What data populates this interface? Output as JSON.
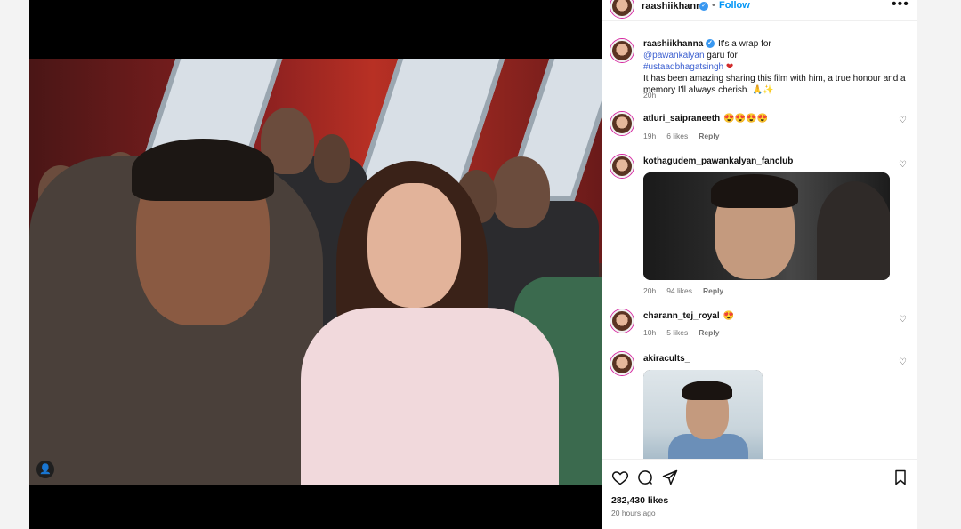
{
  "post": {
    "username": "raashiikhanna",
    "verified_icon": "verified-badge-icon",
    "separator": "•",
    "follow_label": "Follow",
    "more_label": "•••",
    "tag_icon": "person-tag-icon"
  },
  "caption": {
    "username": "raashiikhanna",
    "text_1": "It's a wrap for ",
    "mention": "@pawankalyan",
    "text_2": " garu for ",
    "hashtag": "#ustaadbhagatsingh",
    "heart": "❤",
    "text_3": "It has been amazing sharing this film with him, a true honour and a memory I'll always cherish. 🙏✨",
    "time": "20h"
  },
  "comments": [
    {
      "username": "atluri_saipraneeth",
      "text": "😍😍😍😍",
      "time": "19h",
      "likes": "6 likes",
      "reply": "Reply"
    },
    {
      "username": "kothagudem_pawankalyan_fanclub",
      "text": "",
      "time": "20h",
      "likes": "94 likes",
      "reply": "Reply"
    },
    {
      "username": "charann_tej_royal",
      "text": "😍",
      "time": "10h",
      "likes": "5 likes",
      "reply": "Reply"
    },
    {
      "username": "akiracults_",
      "text": "",
      "time": "",
      "likes": "",
      "reply": ""
    }
  ],
  "like_icon": "♡",
  "footer": {
    "likes": "282,430 likes",
    "time": "20 hours ago"
  },
  "colors": {
    "link": "#3b5fd0",
    "follow": "#0095f6",
    "verified": "#3897f0"
  }
}
